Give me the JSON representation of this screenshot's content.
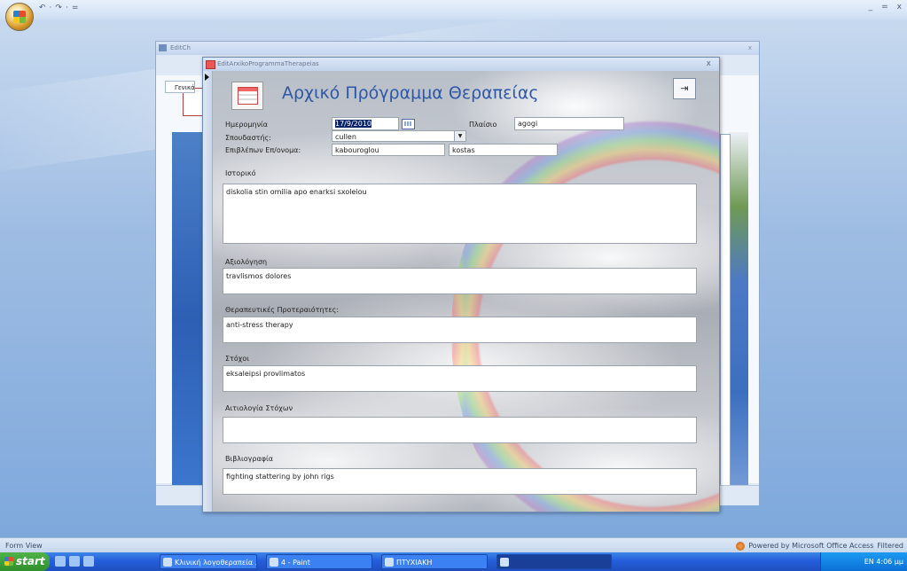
{
  "app": {
    "quick_access": [
      "↶",
      "·",
      "↷",
      "·",
      "="
    ],
    "window_controls": [
      "_",
      "=",
      "x"
    ]
  },
  "back_window": {
    "title": "EditCh",
    "tab_label": "Γενικά"
  },
  "dialog": {
    "title": "EditArxikoProgrammaTherapeias",
    "close": "x",
    "heading": "Αρχικό Πρόγραμμα Θεραπείας",
    "exit_icon": "exit-door-icon",
    "fields": {
      "date_label": "Ημερομηνία",
      "date_value": "17/9/2010",
      "context_label": "Πλαίσιο",
      "context_value": "agogi",
      "student_label": "Σπουδαστής:",
      "student_value": "cullen",
      "supervisor_label": "Επιβλέπων Επ/ονομα:",
      "supervisor_last": "kabouroglou",
      "supervisor_first": "kostas"
    },
    "memos": [
      {
        "label": "Ιστορικό",
        "value": "diskolia stin omilia apo enarksi sxoleiou"
      },
      {
        "label": "Αξιολόγηση",
        "value": "travlismos dolores"
      },
      {
        "label": "Θεραπευτικές Προτεραιότητες:",
        "value": "anti-stress therapy"
      },
      {
        "label": "Στόχοι",
        "value": "eksaleipsi provlimatos"
      },
      {
        "label": "Αιτιολογία Στόχων",
        "value": ""
      },
      {
        "label": "Βιβλιογραφία",
        "value": "fighting stattering by john rigs"
      }
    ]
  },
  "status": {
    "left": "Form View",
    "right_powered": "Powered by Microsoft Office Access",
    "right_filter": "Filtered"
  },
  "taskbar": {
    "start": "start",
    "tasks": [
      "Κλινική λογοθεραπεία ...",
      "4 - Paint",
      "ΠΤΥΧΙΑΚΗ",
      ""
    ],
    "clock": "EN  4:06 μμ"
  }
}
